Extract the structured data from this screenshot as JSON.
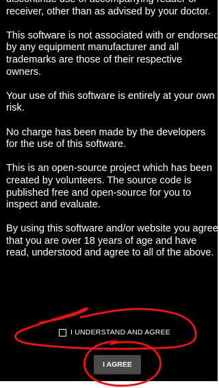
{
  "disclaimer": {
    "paragraphs": [
      "discontinue use of accompanying reader or receiver, other than as advised by your doctor.",
      "This software is not associated with or endorsed by any equipment manufacturer and all trademarks are those of their respective owners.",
      "Your use of this software is entirely at your own risk.",
      "No charge has been made by the developers for the use of this software.",
      "This is an open-source project which has been created by volunteers. The source code is published free and open-source for you to inspect and evaluate.",
      "By using this software and/or website you agree that you are over 18 years of age and have read, understood and agree to all of the above."
    ]
  },
  "consent": {
    "checkbox_label": "I UNDERSTAND AND AGREE",
    "checked": false
  },
  "button": {
    "label": "I AGREE"
  },
  "colors": {
    "background": "#000000",
    "text": "#ffffff",
    "button": "#4a4a4a",
    "annotation": "#e3151a"
  }
}
